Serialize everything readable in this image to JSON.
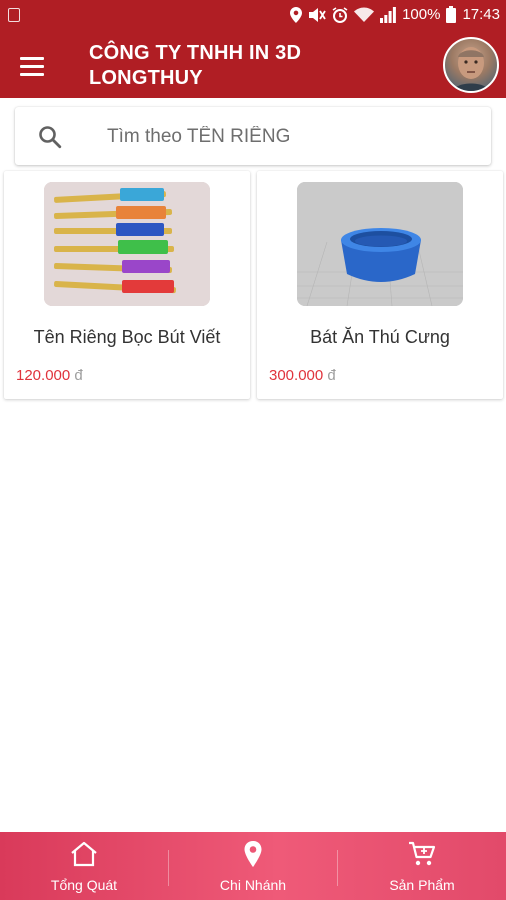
{
  "status_bar": {
    "battery_percent": "100%",
    "time": "17:43",
    "icons": [
      "sim-icon",
      "location-icon",
      "mute-icon",
      "alarm-icon",
      "wifi-icon",
      "signal-icon",
      "battery-icon"
    ]
  },
  "app_bar": {
    "title": "CÔNG TY TNHH IN 3D LONGTHUY",
    "menu_icon": "menu-icon",
    "avatar": "avatar"
  },
  "search": {
    "placeholder": "Tìm theo TÊN RIÊNG",
    "value": "",
    "icon": "search-icon"
  },
  "products": [
    {
      "name": "Tên Riêng Bọc Bút Viết",
      "price": "120.000",
      "currency": "đ"
    },
    {
      "name": "Bát Ăn Thú Cưng",
      "price": "300.000",
      "currency": "đ"
    }
  ],
  "bottom_nav": {
    "items": [
      {
        "label": "Tổng Quát",
        "icon": "home-icon"
      },
      {
        "label": "Chi Nhánh",
        "icon": "location-pin-icon"
      },
      {
        "label": "Sản Phẩm",
        "icon": "cart-icon"
      }
    ]
  },
  "colors": {
    "primary": "#b01e24",
    "price": "#e0333c",
    "bottom_nav_start": "#d93a5a",
    "bottom_nav_end": "#ef5a78"
  }
}
